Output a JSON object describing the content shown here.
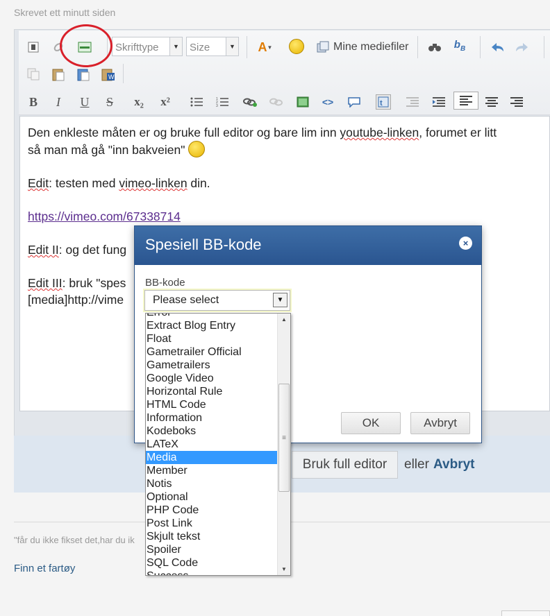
{
  "post": {
    "timestamp": "Skrevet ett minutt siden"
  },
  "toolbar": {
    "font_select": "Skrifttype",
    "size_select": "Size",
    "media_files_label": "Mine mediefiler",
    "format_buttons": [
      "B",
      "I",
      "U",
      "S",
      "x₂",
      "x²"
    ]
  },
  "content": {
    "line1": "Den enkleste måten er og bruke full editor og bare lim inn ",
    "line1_squiggle": "youtube-linken",
    "line1_end": ", forumet er litt",
    "line2": "så man må gå \"inn bakveien\" ",
    "line3_label": "Edit",
    "line3": ": testen med ",
    "line3_squiggle": "vimeo-linken",
    "line3_end": " din.",
    "link": "https://vimeo.com/67338714",
    "line4_label": "Edit II",
    "line4": ": og det fung",
    "line5_label": "Edit III",
    "line5": ": bruk \"spes",
    "line6": "[media]http://vime"
  },
  "actions": {
    "full_editor": "Bruk full editor",
    "or": "eller",
    "cancel": "Avbryt"
  },
  "signature": "\"får du ikke fikset det,har du ik",
  "footer_link": "Finn et fartøy",
  "modal": {
    "title": "Spesiell BB-kode",
    "close": "×",
    "field_label": "BB-kode",
    "select_value": "Please select",
    "ok": "OK",
    "cancel": "Avbryt"
  },
  "dropdown": {
    "options": [
      "Error",
      "Extract Blog Entry",
      "Float",
      "Gametrailer Official",
      "Gametrailers",
      "Google Video",
      "Horizontal Rule",
      "HTML Code",
      "Information",
      "Kodeboks",
      "LATeX",
      "Media",
      "Member",
      "Notis",
      "Optional",
      "PHP Code",
      "Post Link",
      "Skjult tekst",
      "Spoiler",
      "SQL Code",
      "Success"
    ],
    "selected": "Media"
  },
  "colors": {
    "modal_header": "#2a5590",
    "selected_option": "#3399ff",
    "highlight_circle": "#d9202a",
    "link": "#5b2d8e"
  }
}
